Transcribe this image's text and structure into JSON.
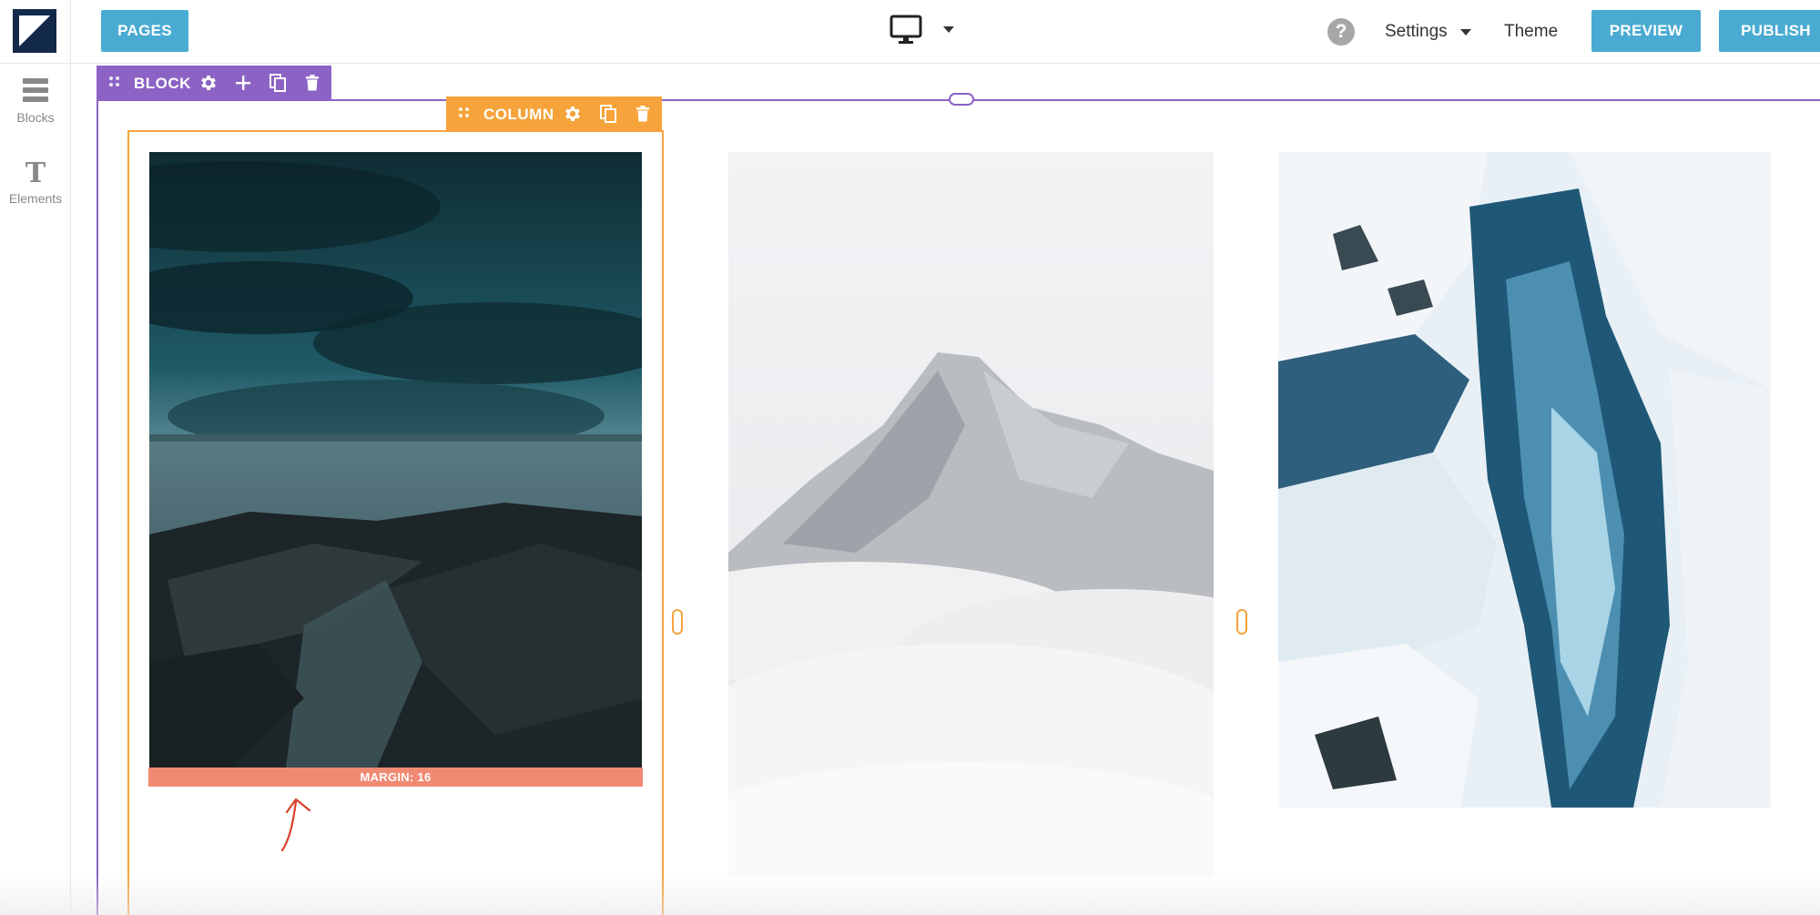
{
  "topbar": {
    "pages_label": "PAGES",
    "settings_label": "Settings",
    "theme_label": "Theme",
    "preview_label": "PREVIEW",
    "publish_label": "PUBLISH",
    "help_glyph": "?",
    "device_icon": "desktop-monitor-icon"
  },
  "sidebar": {
    "items": [
      {
        "label": "Blocks",
        "icon": "stack-icon"
      },
      {
        "label": "Elements",
        "icon": "text-t-icon"
      }
    ]
  },
  "block_toolbar": {
    "label": "BLOCK",
    "icons": [
      "drag-handle-icon",
      "gear-icon",
      "plus-icon",
      "copy-icon",
      "trash-icon"
    ]
  },
  "column_toolbar": {
    "label": "COLUMN",
    "icons": [
      "drag-handle-icon",
      "gear-icon",
      "copy-icon",
      "trash-icon"
    ]
  },
  "columns": [
    {
      "image": "stormy-coast-rocks-photo",
      "margin_label": "MARGIN: 16"
    },
    {
      "image": "misty-mountain-photo"
    },
    {
      "image": "frozen-waterfall-canyon-photo"
    }
  ],
  "colors": {
    "accent_blue": "#4aabd2",
    "block_purple": "#8c63c4",
    "column_orange": "#f5a33a",
    "margin_salmon": "#f08a73",
    "logo_navy": "#13294b"
  }
}
